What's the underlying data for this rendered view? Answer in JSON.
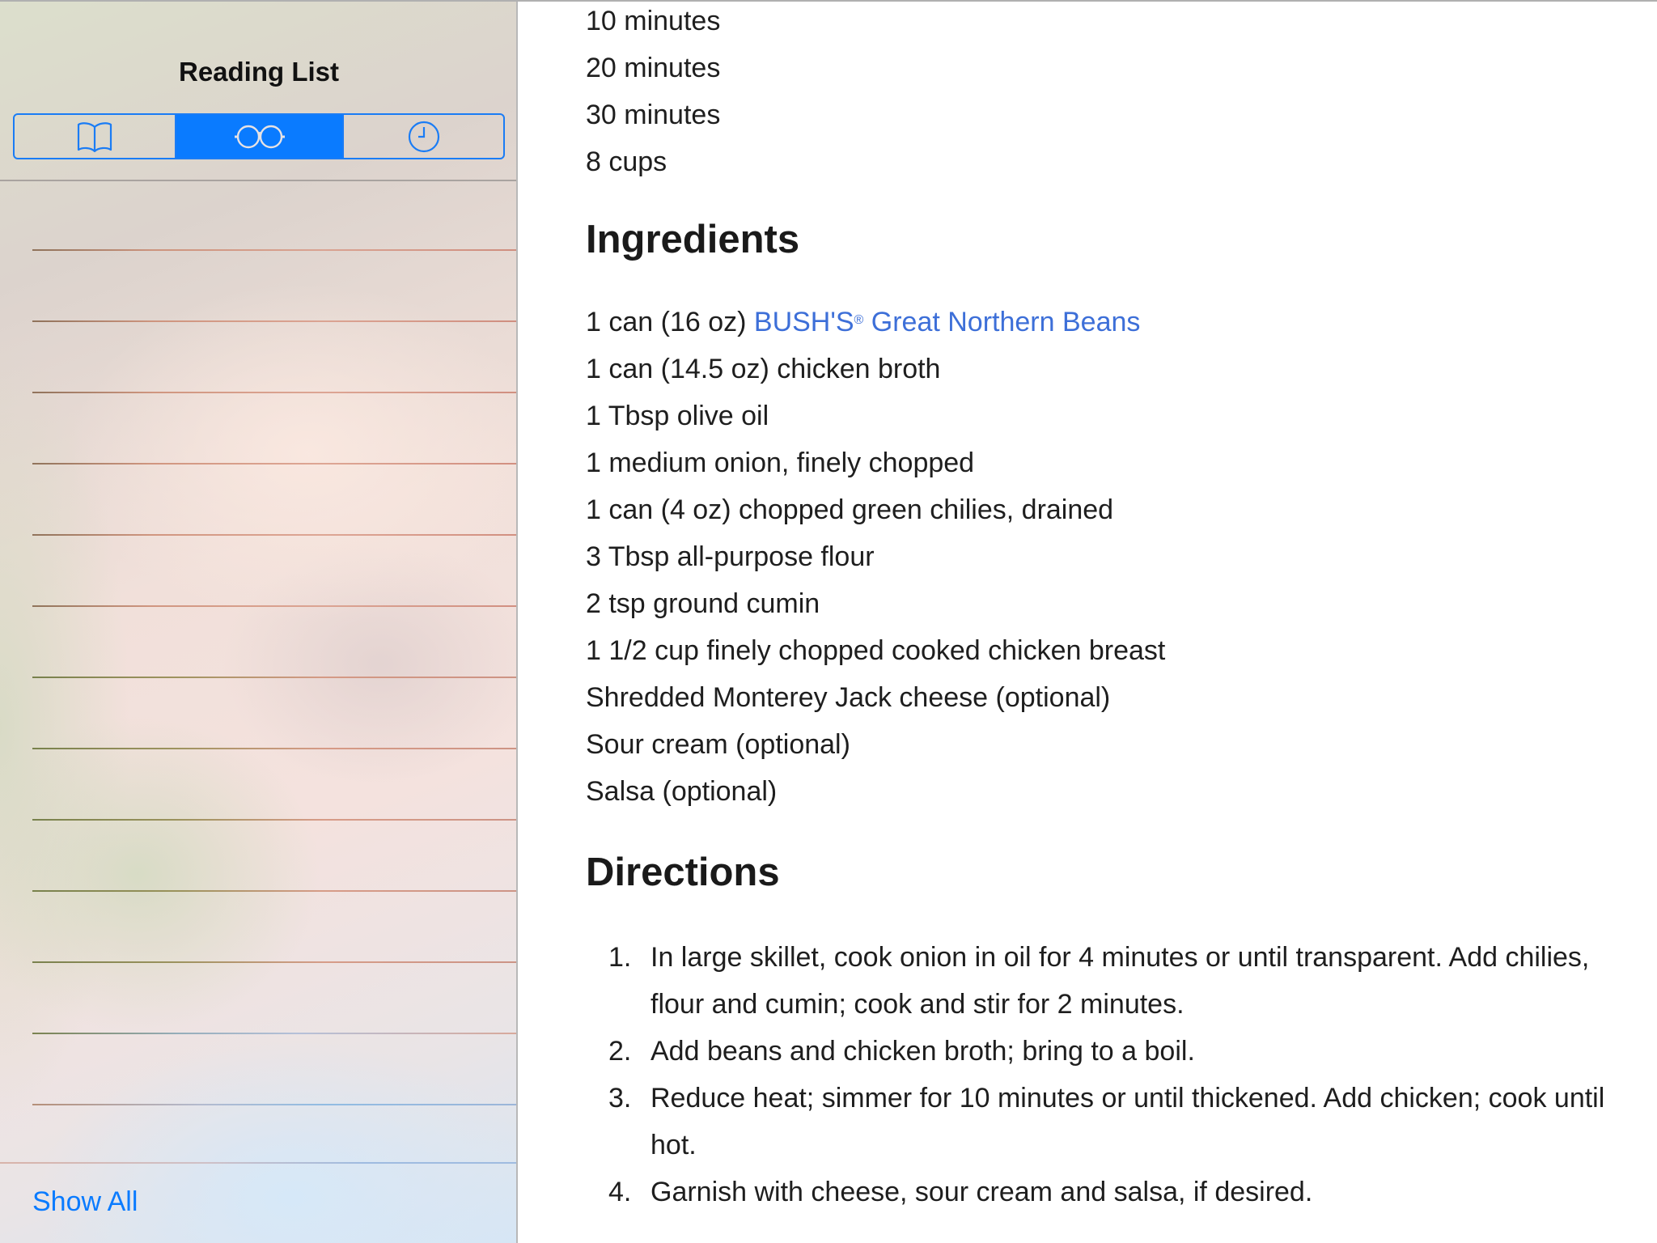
{
  "sidebar": {
    "title": "Reading List",
    "segments": [
      {
        "name": "bookmarks",
        "icon": "book-icon",
        "selected": false
      },
      {
        "name": "reading-list",
        "icon": "glasses-icon",
        "selected": true
      },
      {
        "name": "history",
        "icon": "clock-icon",
        "selected": false
      }
    ],
    "row_count": 13,
    "show_all_label": "Show All",
    "accent_color": "#007AFF"
  },
  "article": {
    "meta": [
      "10 minutes",
      "20 minutes",
      "30 minutes",
      "8 cups"
    ],
    "ingredients_heading": "Ingredients",
    "ingredients": {
      "first_prefix": "1 can (16 oz) ",
      "first_link_brand": "BUSH'S",
      "first_link_mark": "®",
      "first_link_rest": " Great Northern Beans",
      "others": [
        "1 can (14.5 oz) chicken broth",
        "1 Tbsp olive oil",
        "1 medium onion, finely chopped",
        "1 can (4 oz) chopped green chilies, drained",
        "3 Tbsp all-purpose flour",
        "2 tsp ground cumin",
        "1 1/2 cup finely chopped cooked chicken breast",
        "Shredded Monterey Jack cheese (optional)",
        "Sour cream (optional)",
        "Salsa (optional)"
      ]
    },
    "directions_heading": "Directions",
    "directions": [
      {
        "num": "1.",
        "text": "In large skillet, cook onion in oil for 4 minutes or until transparent. Add chilies, flour and cumin; cook and stir for 2 minutes."
      },
      {
        "num": "2.",
        "text": "Add beans and chicken broth; bring to a boil."
      },
      {
        "num": "3.",
        "text": "Reduce heat; simmer for 10 minutes or until thickened. Add chicken; cook until hot."
      },
      {
        "num": "4.",
        "text": "Garnish with cheese, sour cream and salsa, if desired."
      }
    ],
    "link_color": "#3D6FD8"
  }
}
